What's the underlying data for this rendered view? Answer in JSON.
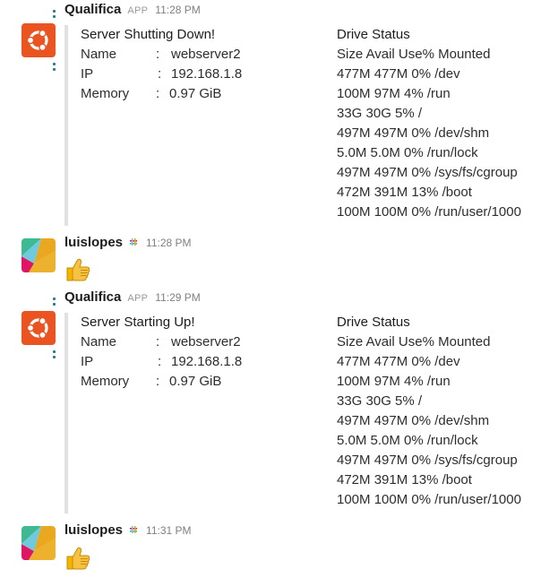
{
  "messages": [
    {
      "type": "bot",
      "sender": "Qualifica",
      "badge": "APP",
      "time": "11:28 PM",
      "attachment": {
        "title": "Server Shutting Down!",
        "fields": [
          {
            "label": "Name",
            "sep": ":",
            "value": "webserver2"
          },
          {
            "label": "IP",
            "sep": ":",
            "value": "192.168.1.8"
          },
          {
            "label": "Memory",
            "sep": ":",
            "value": "0.97 GiB"
          }
        ],
        "drive_title": "Drive Status",
        "drive_lines": [
          "Size Avail Use% Mounted",
          "477M 477M 0% /dev",
          "100M 97M 4% /run",
          "33G 30G 5% /",
          "497M 497M 0% /dev/shm",
          "5.0M 5.0M 0% /run/lock",
          "497M 497M 0% /sys/fs/cgroup",
          "472M 391M 13% /boot",
          "100M 100M 0% /run/user/1000"
        ]
      }
    },
    {
      "type": "user",
      "sender": "luislopes",
      "time": "11:28 PM",
      "emoji": "thumbs-up"
    },
    {
      "type": "bot",
      "sender": "Qualifica",
      "badge": "APP",
      "time": "11:29 PM",
      "attachment": {
        "title": "Server Starting Up!",
        "fields": [
          {
            "label": "Name",
            "sep": ":",
            "value": "webserver2"
          },
          {
            "label": "IP",
            "sep": ":",
            "value": "192.168.1.8"
          },
          {
            "label": "Memory",
            "sep": ":",
            "value": "0.97 GiB"
          }
        ],
        "drive_title": "Drive Status",
        "drive_lines": [
          "Size Avail Use% Mounted",
          "477M 477M 0% /dev",
          "100M 97M 4% /run",
          "33G 30G 5% /",
          "497M 497M 0% /dev/shm",
          "5.0M 5.0M 0% /run/lock",
          "497M 497M 0% /sys/fs/cgroup",
          "472M 391M 13% /boot",
          "100M 100M 0% /run/user/1000"
        ]
      }
    },
    {
      "type": "user",
      "sender": "luislopes",
      "time": "11:31 PM",
      "emoji": "thumbs-up"
    }
  ],
  "colors": {
    "ubuntu_orange": "#e95420",
    "attachment_border": "#e1e1e1",
    "gutter_dot": "#2a7a8a"
  }
}
